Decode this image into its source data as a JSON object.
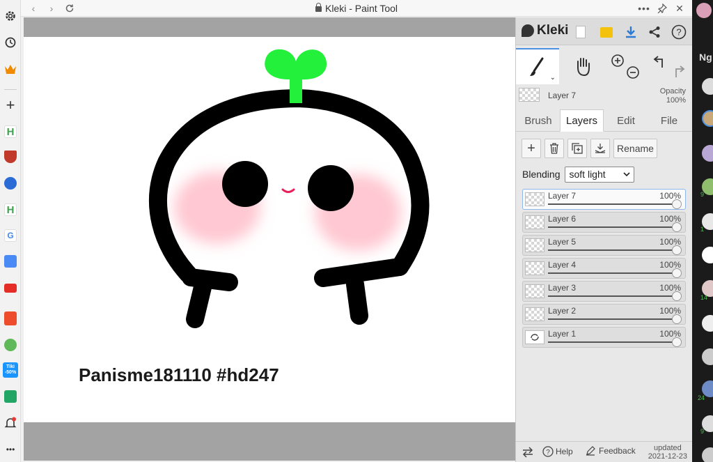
{
  "window": {
    "title": "Kleki - Paint Tool",
    "controls": [
      "back",
      "forward",
      "reload",
      "more",
      "pin",
      "close"
    ]
  },
  "left_sidebar": {
    "items": [
      "settings-icon",
      "history-icon",
      "crown-icon",
      "add-icon",
      "h-app-icon",
      "shield-app-icon",
      "kleki-app-icon",
      "h-app-icon",
      "google-icon",
      "translate-icon",
      "youtube-icon",
      "shopee-icon",
      "maps-icon",
      "tiki-icon",
      "sheets-icon",
      "bell-icon",
      "more-icon"
    ],
    "tiki_label": "Tiki",
    "tiki_badge": "-50%",
    "more_label": "•••"
  },
  "canvas": {
    "caption": "Panisme181110 #hd247",
    "colors": {
      "stroke": "#000000",
      "sprout": "#22f03a",
      "blush": "#ffc8d2",
      "mouth": "#e8205a"
    }
  },
  "panel": {
    "logo": "Kleki",
    "current_layer": "Layer 7",
    "opacity_label": "Opacity",
    "opacity_value": "100%",
    "tabs": [
      {
        "label": "Brush"
      },
      {
        "label": "Layers"
      },
      {
        "label": "Edit"
      },
      {
        "label": "File"
      }
    ],
    "active_tab": "Layers",
    "rename_label": "Rename",
    "blending_label": "Blending",
    "blending_value": "soft light",
    "layers": [
      {
        "name": "Layer 7",
        "opacity": "100%",
        "selected": true
      },
      {
        "name": "Layer 6",
        "opacity": "100%",
        "selected": false
      },
      {
        "name": "Layer 5",
        "opacity": "100%",
        "selected": false
      },
      {
        "name": "Layer 4",
        "opacity": "100%",
        "selected": false
      },
      {
        "name": "Layer 3",
        "opacity": "100%",
        "selected": false
      },
      {
        "name": "Layer 2",
        "opacity": "100%",
        "selected": false
      },
      {
        "name": "Layer 1",
        "opacity": "100%",
        "selected": false
      }
    ],
    "bottom": {
      "help": "Help",
      "feedback": "Feedback",
      "updated_label": "updated",
      "updated_date": "2021-12-23"
    },
    "accent": "#4a8fe0"
  },
  "right_strip": {
    "label": "Ng",
    "badges": [
      "9",
      "1",
      "14",
      "24",
      "9"
    ]
  }
}
